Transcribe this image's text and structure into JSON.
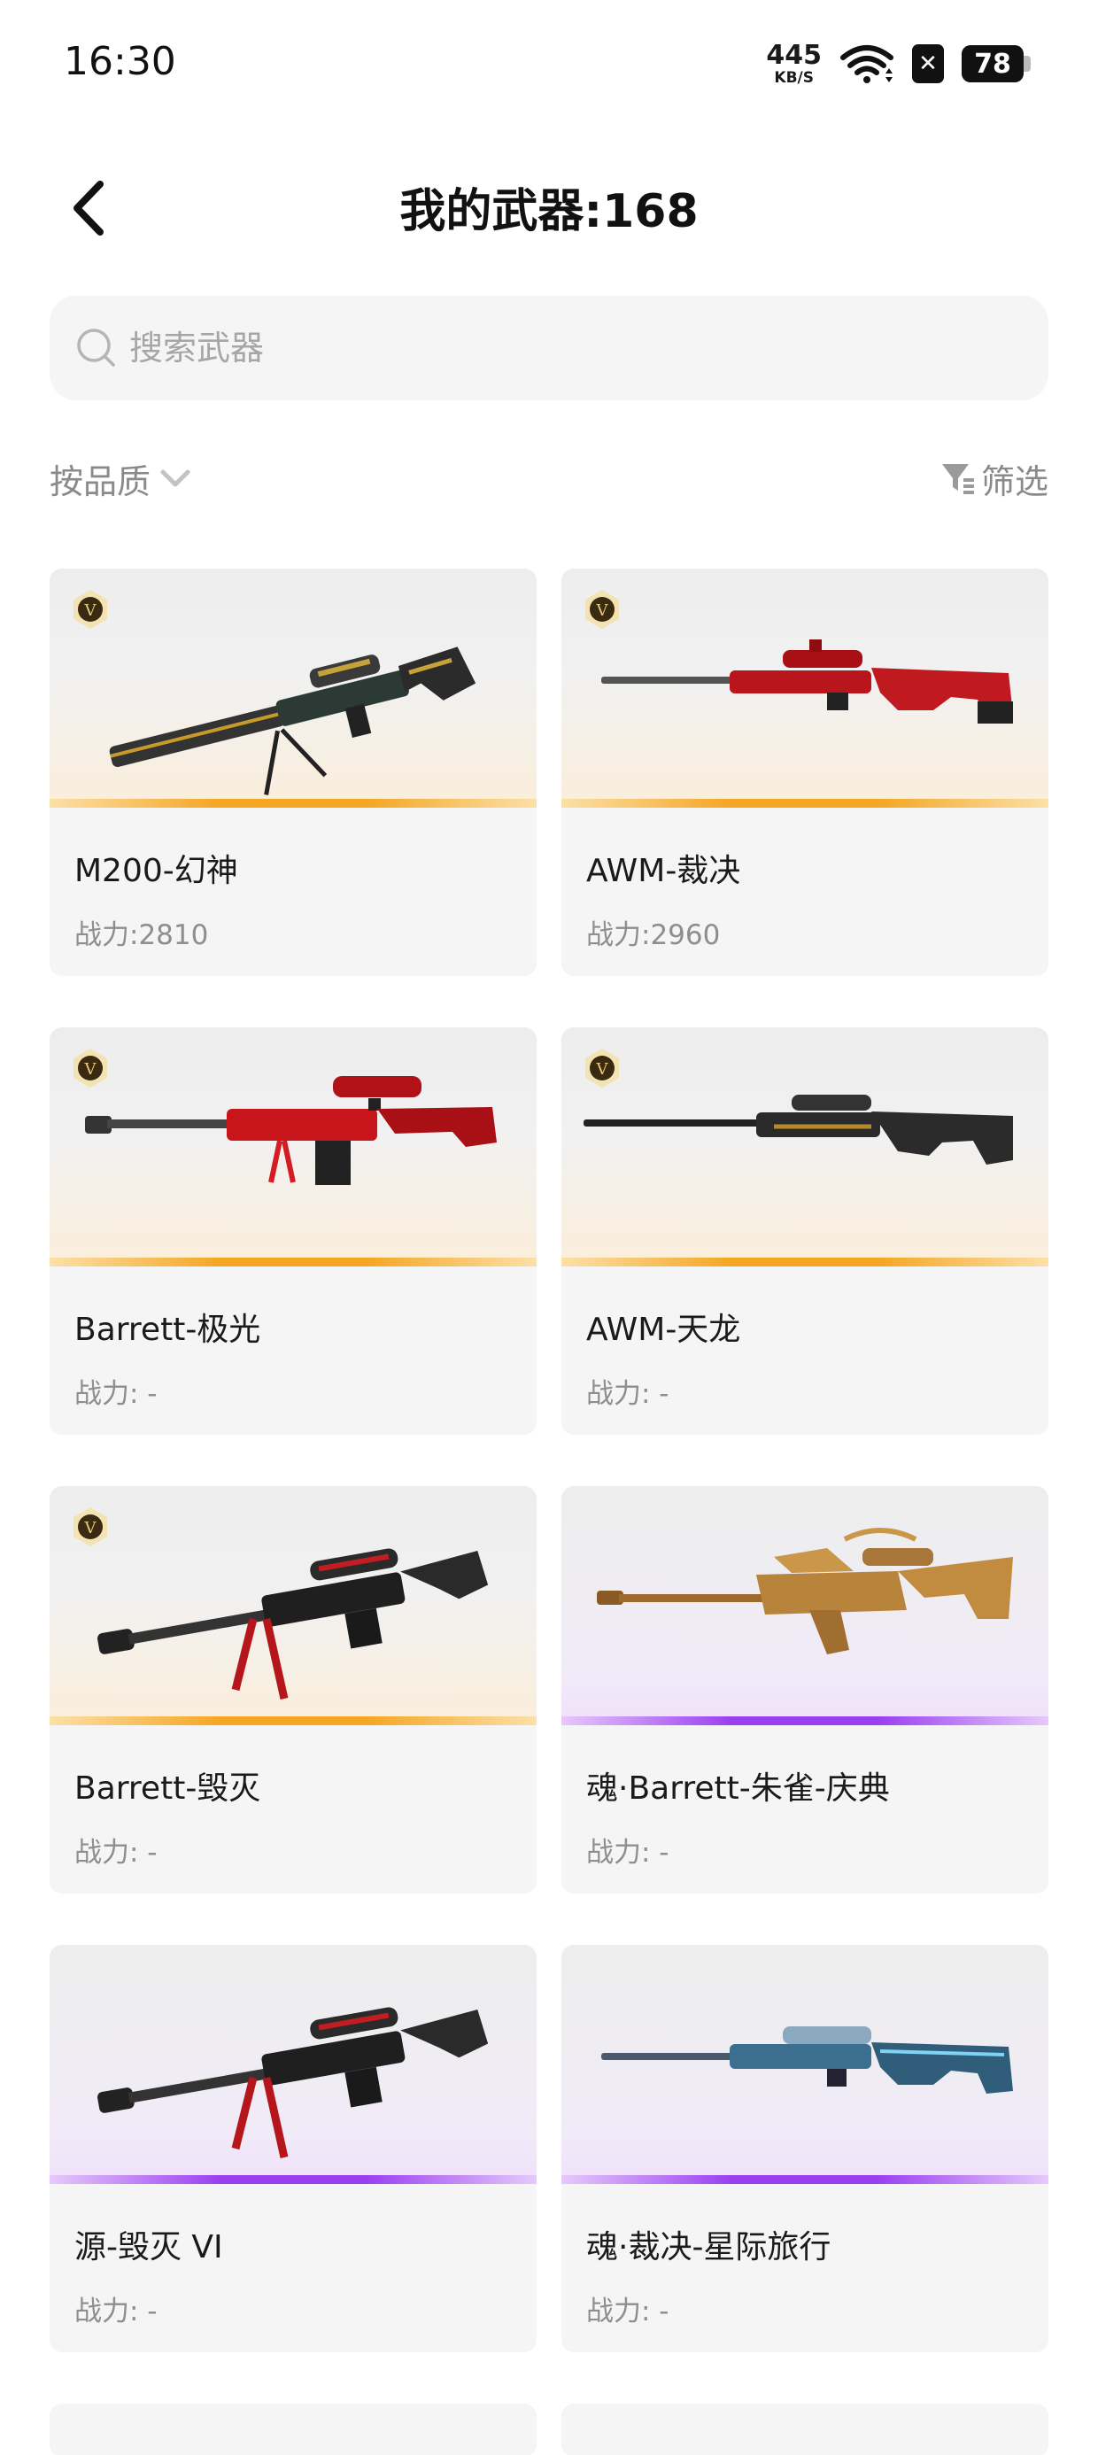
{
  "status_bar": {
    "time": "16:30",
    "net_speed": "445",
    "net_unit": "KB/S",
    "battery": "78"
  },
  "header": {
    "title": "我的武器:168"
  },
  "search": {
    "placeholder": "搜索武器"
  },
  "filters": {
    "sort_label": "按品质",
    "filter_label": "筛选"
  },
  "colors": {
    "gold_rarity": "#f5a623",
    "purple_rarity": "#9a3ff0",
    "card_bg": "#f5f5f5"
  },
  "weapons": [
    {
      "name": "M200-幻神",
      "power": "战力:2810",
      "rarity": "gold",
      "badge": "V"
    },
    {
      "name": "AWM-裁决",
      "power": "战力:2960",
      "rarity": "gold",
      "badge": "V"
    },
    {
      "name": "Barrett-极光",
      "power": "战力: -",
      "rarity": "gold",
      "badge": "V"
    },
    {
      "name": "AWM-天龙",
      "power": "战力: -",
      "rarity": "gold",
      "badge": "V"
    },
    {
      "name": "Barrett-毁灭",
      "power": "战力: -",
      "rarity": "gold",
      "badge": "V"
    },
    {
      "name": "魂·Barrett-朱雀-庆典",
      "power": "战力: -",
      "rarity": "purple",
      "badge": ""
    },
    {
      "name": "源-毁灭 VI",
      "power": "战力: -",
      "rarity": "purple",
      "badge": ""
    },
    {
      "name": "魂·裁决-星际旅行",
      "power": "战力: -",
      "rarity": "purple",
      "badge": ""
    }
  ]
}
